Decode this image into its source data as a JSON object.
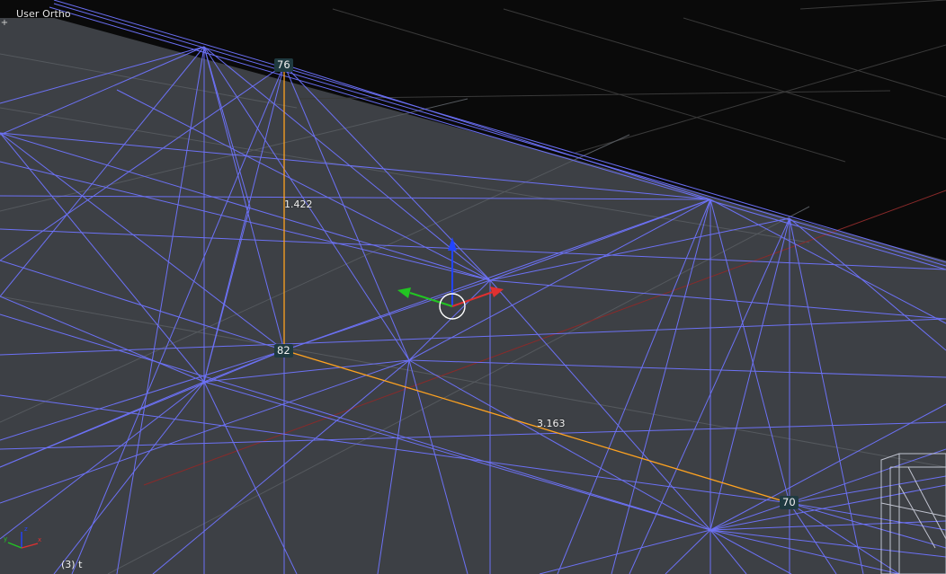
{
  "viewport": {
    "view_label": "User Ortho",
    "frame_info": "(3) t",
    "add_widget_label": "+"
  },
  "vertices": [
    {
      "id": "v76",
      "label": "76"
    },
    {
      "id": "v82",
      "label": "82"
    },
    {
      "id": "v70",
      "label": "70"
    }
  ],
  "dimensions": [
    {
      "id": "edge-76-82",
      "label": "1.422"
    },
    {
      "id": "edge-82-70",
      "label": "3.163"
    }
  ],
  "colors": {
    "background_void": "#0a0a0a",
    "ground": "#3d4045",
    "wire": "#6f74ff",
    "measure_edge": "#ffa320",
    "badge": "#1f3a40",
    "axis_x": "#e03030",
    "axis_y": "#22c422",
    "axis_z": "#2244ff"
  },
  "icons": {
    "manipulator": "transform-manipulator-icon",
    "axes": "view-axes-icon"
  }
}
